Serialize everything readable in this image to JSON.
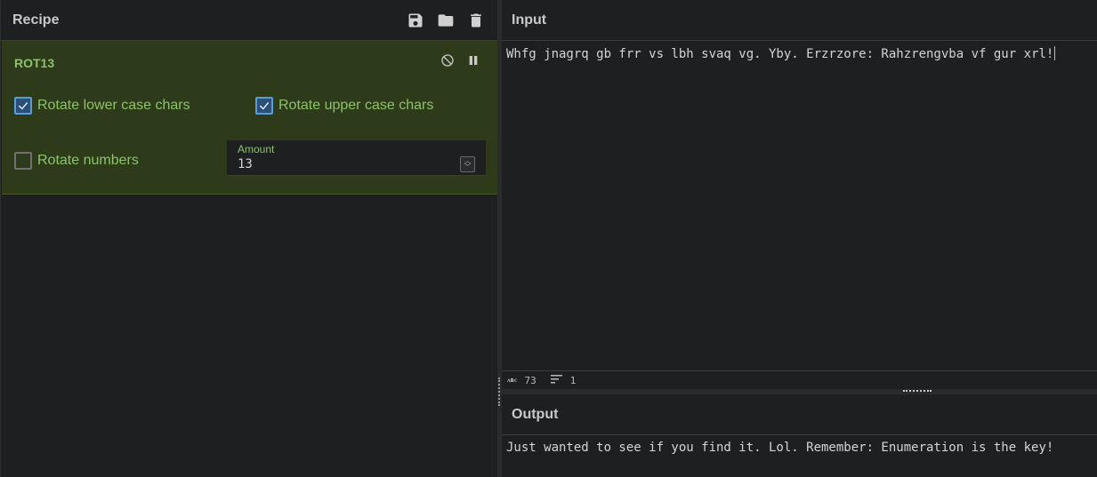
{
  "recipe": {
    "title": "Recipe",
    "icons": [
      "save-icon",
      "folder-icon",
      "trash-icon"
    ],
    "operation": {
      "name": "ROT13",
      "options": {
        "rotate_lower": {
          "label": "Rotate lower case chars",
          "checked": true
        },
        "rotate_upper": {
          "label": "Rotate upper case chars",
          "checked": true
        },
        "rotate_numbers": {
          "label": "Rotate numbers",
          "checked": false
        },
        "amount": {
          "label": "Amount",
          "value": "13"
        }
      }
    }
  },
  "input": {
    "title": "Input",
    "text": "Whfg jnagrq gb frr vs lbh svaq vg. Yby. Erzrzore: Rahzrengvba vf gur xrl!",
    "status": {
      "length_label": "ᴀʙᴄ",
      "length": "73",
      "lines": "1"
    }
  },
  "output": {
    "title": "Output",
    "text": "Just wanted to see if you find it. Lol. Remember: Enumeration is the key!"
  },
  "colors": {
    "operation_bg": "#2e3b1a",
    "operation_text": "#8cc26a",
    "checkbox_on": "#5c9bd6"
  }
}
